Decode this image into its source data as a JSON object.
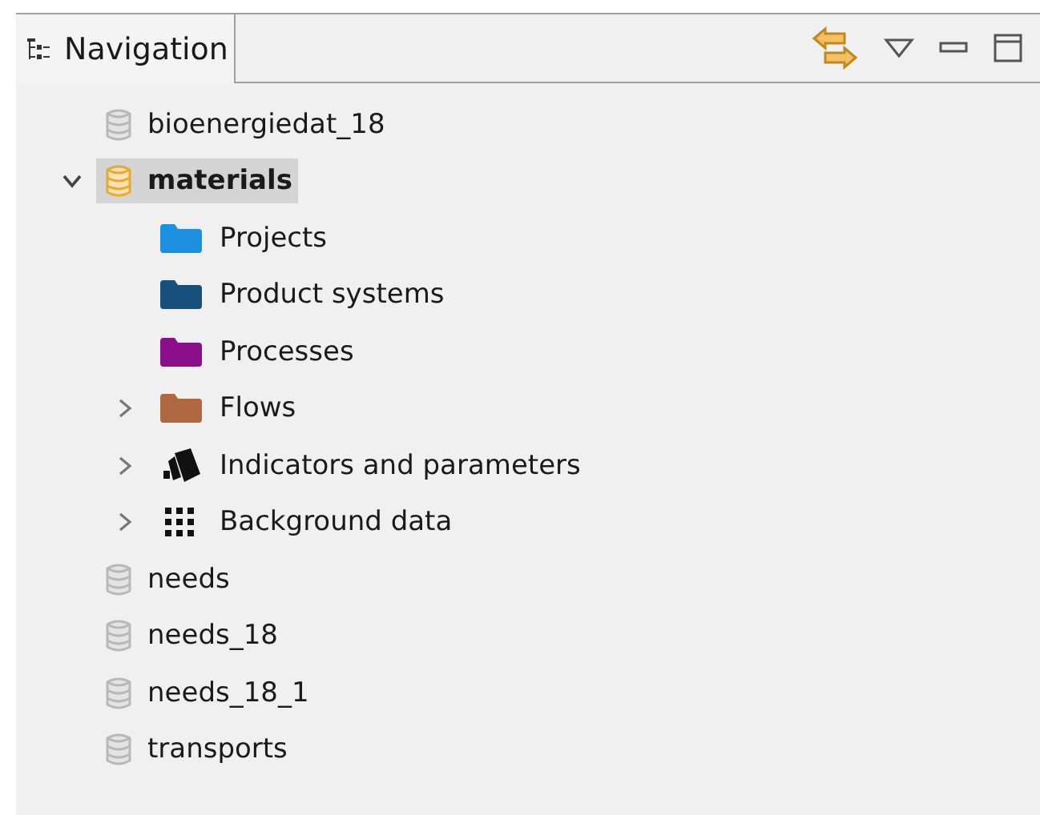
{
  "view": {
    "title": "Navigation",
    "selected": true
  },
  "tree": [
    {
      "kind": "database",
      "label": "bioenergiedat_18",
      "active": false,
      "selected": false
    },
    {
      "kind": "database",
      "label": "materials",
      "active": true,
      "selected": true,
      "expanded": true,
      "children": [
        {
          "kind": "folder",
          "label": "Projects",
          "color": "#1e90e0"
        },
        {
          "kind": "folder",
          "label": "Product systems",
          "color": "#17507a"
        },
        {
          "kind": "folder",
          "label": "Processes",
          "color": "#8a0f8a"
        },
        {
          "kind": "folder",
          "label": "Flows",
          "color": "#b06840",
          "expanded": false
        },
        {
          "kind": "indicators",
          "label": "Indicators and parameters",
          "expanded": false
        },
        {
          "kind": "background",
          "label": "Background data",
          "expanded": false
        }
      ]
    },
    {
      "kind": "database",
      "label": "needs",
      "active": false,
      "selected": false
    },
    {
      "kind": "database",
      "label": "needs_18",
      "active": false,
      "selected": false
    },
    {
      "kind": "database",
      "label": "needs_18_1",
      "active": false,
      "selected": false
    },
    {
      "kind": "database",
      "label": "transports",
      "active": false,
      "selected": false
    }
  ]
}
